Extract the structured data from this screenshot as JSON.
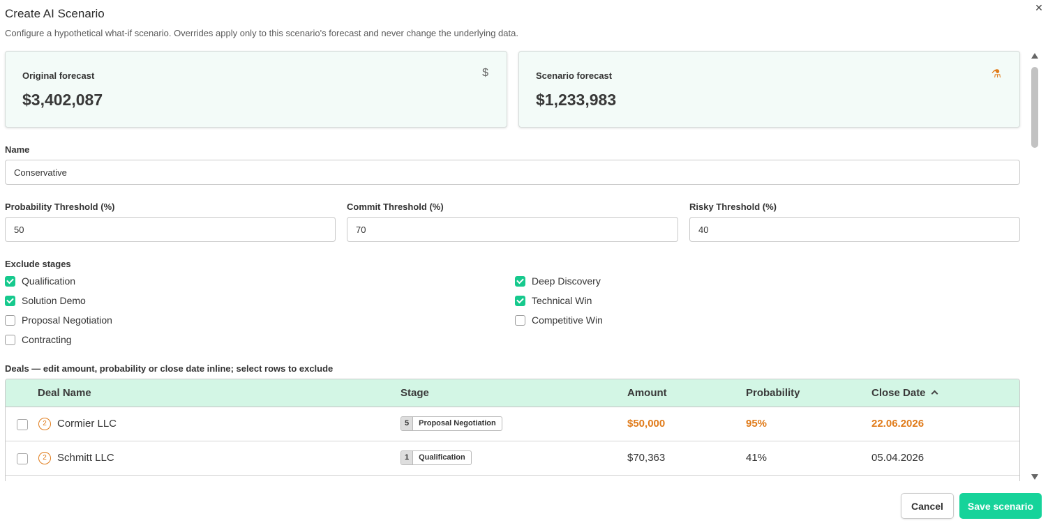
{
  "dialog": {
    "title": "Create AI Scenario",
    "subtitle": "Configure a hypothetical what-if scenario. Overrides apply only to this scenario's forecast and never change the underlying data.",
    "close_glyph": "✕"
  },
  "cards": {
    "original": {
      "label": "Original forecast",
      "value": "$3,402,087",
      "icon": "dollar-icon",
      "glyph": "$"
    },
    "scenario": {
      "label": "Scenario forecast",
      "value": "$1,233,983",
      "icon": "flask-icon",
      "glyph": "⚗"
    }
  },
  "name_field": {
    "label": "Name",
    "value": "Conservative"
  },
  "thresholds": {
    "probability": {
      "label": "Probability Threshold (%)",
      "value": "50"
    },
    "commit": {
      "label": "Commit Threshold (%)",
      "value": "70"
    },
    "risky": {
      "label": "Risky Threshold (%)",
      "value": "40"
    }
  },
  "exclude_stages": {
    "label": "Exclude stages",
    "items": [
      {
        "label": "Qualification",
        "checked": true
      },
      {
        "label": "Deep Discovery",
        "checked": true
      },
      {
        "label": "Solution Demo",
        "checked": true
      },
      {
        "label": "Technical Win",
        "checked": true
      },
      {
        "label": "Proposal Negotiation",
        "checked": false
      },
      {
        "label": "Competitive Win",
        "checked": false
      },
      {
        "label": "Contracting",
        "checked": false
      }
    ]
  },
  "deals": {
    "label": "Deals — edit amount, probability or close date inline; select rows to exclude",
    "columns": [
      "Deal Name",
      "Stage",
      "Amount",
      "Probability",
      "Close Date"
    ],
    "sort_column": "Close Date",
    "rows": [
      {
        "priority": "2",
        "name": "Cormier LLC",
        "stage_num": "5",
        "stage": "Proposal Negotiation",
        "amount": "$50,000",
        "probability": "95%",
        "close_date": "22.06.2026",
        "highlighted": true
      },
      {
        "priority": "2",
        "name": "Schmitt LLC",
        "stage_num": "1",
        "stage": "Qualification",
        "amount": "$70,363",
        "probability": "41%",
        "close_date": "05.04.2026",
        "highlighted": false
      }
    ]
  },
  "footer": {
    "cancel_label": "Cancel",
    "save_label": "Save scenario"
  },
  "colors": {
    "accent": "#16d39a",
    "highlight": "#e07b1a",
    "header_bg": "#d3f6e5",
    "card_bg": "#f3fbf8"
  }
}
